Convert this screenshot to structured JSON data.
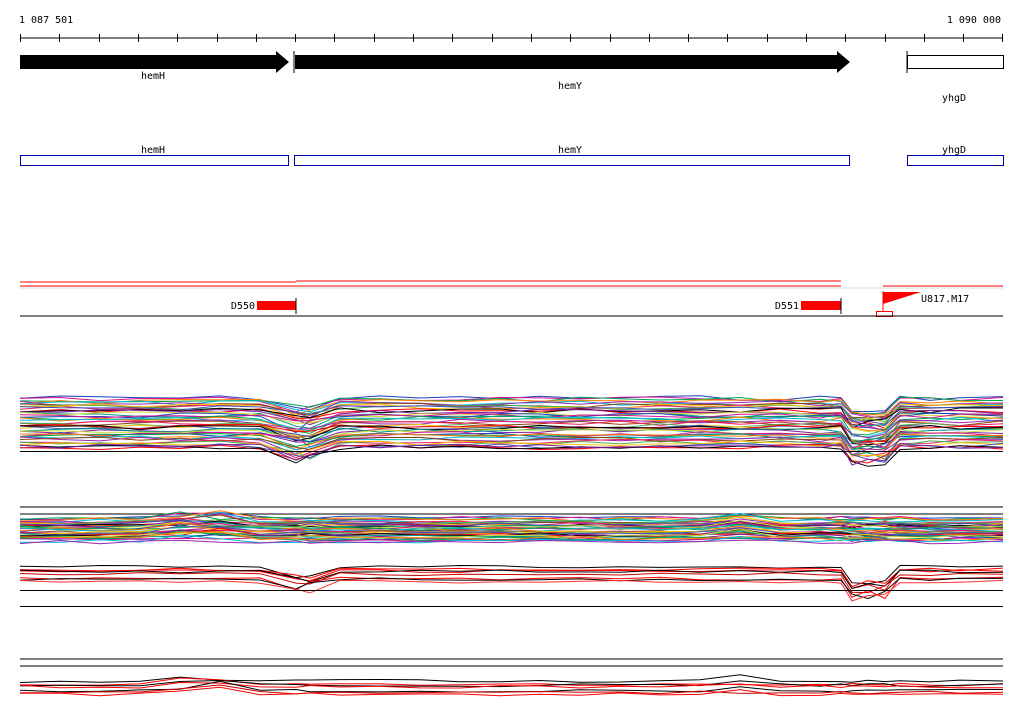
{
  "ruler": {
    "start_label": "1 087 501",
    "end_label": "1 090 000"
  },
  "genes": [
    {
      "name": "hemH",
      "strand": "+",
      "filled": true
    },
    {
      "name": "hemY",
      "strand": "+",
      "filled": true
    },
    {
      "name": "yhgD",
      "strand": "",
      "filled": false
    }
  ],
  "annotation_boxes": [
    {
      "name": "hemH"
    },
    {
      "name": "hemY"
    },
    {
      "name": "yhgD"
    }
  ],
  "features": [
    {
      "label": "D550",
      "type": "deletion"
    },
    {
      "label": "D551",
      "type": "deletion"
    },
    {
      "label": "U817.M17",
      "type": "insertion"
    }
  ],
  "colors": {
    "gene_fill": "#000000",
    "annotation_box": "#0000aa",
    "feature_red": "#ff0000",
    "axis": "#000000",
    "trace_palette": [
      "#1f3fbf",
      "#d4148e",
      "#00a651",
      "#ff7f00",
      "#00bcd4",
      "#9c27b0",
      "#8b4513",
      "#e91e63",
      "#4caf50",
      "#ffc107",
      "#3f51b5",
      "#ff0000",
      "#000000",
      "#7b1fa2",
      "#009688",
      "#cddc39"
    ]
  }
}
